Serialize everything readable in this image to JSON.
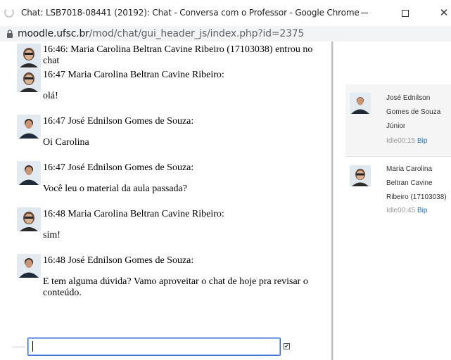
{
  "window": {
    "title": "Chat: LSB7018-08441 (20192): Chat - Conversa com o Professor - Google Chrome",
    "min_label": "—",
    "max_label": "☐",
    "close_label": "✕"
  },
  "address": {
    "host": "moodle.ufsc.br",
    "path": "/mod/chat/gui_header_js/index.php?id=2375"
  },
  "messages": [
    {
      "type": "system",
      "head_line1": "16:46: Maria Carolina Beltran Cavine Ribeiro (17103038) entrou no",
      "head_line2": "chat",
      "avatar": "maria"
    },
    {
      "type": "message",
      "head": "16:47 Maria Carolina Beltran Cavine Ribeiro:",
      "body": "olá!",
      "avatar": "maria"
    },
    {
      "type": "message",
      "head": "16:47 José Ednilson Gomes de Souza:",
      "body": "Oi Carolina",
      "avatar": "jose"
    },
    {
      "type": "message",
      "head": "16:47 José Ednilson Gomes de Souza:",
      "body": "Você leu o material da aula passada?",
      "avatar": "jose"
    },
    {
      "type": "message",
      "head": "16:48 Maria Carolina Beltran Cavine Ribeiro:",
      "body": "sim!",
      "avatar": "maria"
    },
    {
      "type": "message",
      "head": "16:48 José Ednilson Gomes de Souza:",
      "body_line1": "E tem alguma dúvida? Vamo aproveitar o chat de hoje pra revisar o",
      "body_line2": "conteúdo.",
      "avatar": "jose"
    }
  ],
  "input": {
    "value": "",
    "checkbox_mark": "✔"
  },
  "users": [
    {
      "name_line1": "José Ednilson",
      "name_line2": "Gomes de Souza",
      "name_line3": "Júnior",
      "idle": "Idle00:15",
      "bip": "Bip"
    },
    {
      "name_line1": "Maria Carolina",
      "name_line2": "Beltran Cavine",
      "name_line3": "Ribeiro (17103038)",
      "idle": "Idle00:45",
      "bip": "Bip"
    }
  ],
  "colors": {
    "input_focus": "#3367d6",
    "bip_link": "#1f74c7",
    "address_bar_bg": "#f1f3f4"
  }
}
